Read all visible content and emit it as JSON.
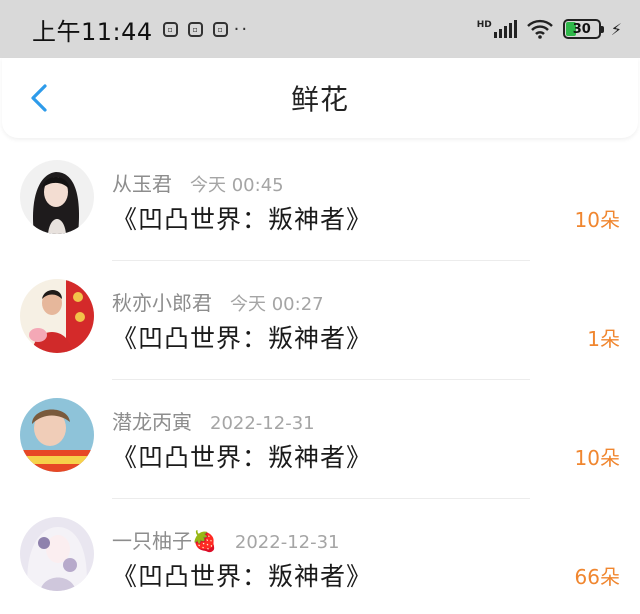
{
  "statusbar": {
    "time": "上午11:44",
    "network": "HD",
    "battery": "30",
    "icons": [
      "notification-icon-1",
      "notification-icon-2",
      "notification-icon-3"
    ]
  },
  "header": {
    "title": "鲜花",
    "back_icon": "chevron-left-icon"
  },
  "colors": {
    "accent": "#f0862f",
    "back": "#2e9bea"
  },
  "items": [
    {
      "name": "从玉君",
      "time": "今天 00:45",
      "book": "《凹凸世界：叛神者》",
      "count": "10朵"
    },
    {
      "name": "秋亦小郎君",
      "time": "今天 00:27",
      "book": "《凹凸世界：叛神者》",
      "count": "1朵"
    },
    {
      "name": "潜龙丙寅",
      "time": "2022-12-31",
      "book": "《凹凸世界：叛神者》",
      "count": "10朵"
    },
    {
      "name": "一只柚子🍓",
      "time": "2022-12-31",
      "book": "《凹凸世界：叛神者》",
      "count": "66朵"
    }
  ]
}
